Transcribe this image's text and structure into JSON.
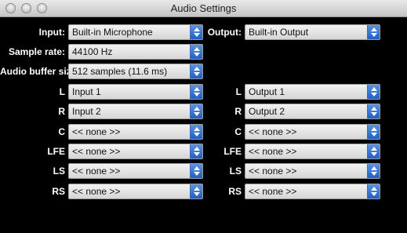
{
  "window": {
    "title": "Audio Settings"
  },
  "labels": {
    "input": "Input:",
    "output": "Output:",
    "sample_rate": "Sample rate:",
    "buffer_size": "Audio buffer size:"
  },
  "selects": {
    "input_device": "Built-in Microphone",
    "output_device": "Built-in Output",
    "sample_rate": "44100 Hz",
    "buffer_size": "512 samples (11.6 ms)"
  },
  "channels": [
    {
      "label": "L",
      "input": "Input 1",
      "output": "Output 1"
    },
    {
      "label": "R",
      "input": "Input 2",
      "output": "Output 2"
    },
    {
      "label": "C",
      "input": "<< none >>",
      "output": "<< none >>"
    },
    {
      "label": "LFE",
      "input": "<< none >>",
      "output": "<< none >>"
    },
    {
      "label": "LS",
      "input": "<< none >>",
      "output": "<< none >>"
    },
    {
      "label": "RS",
      "input": "<< none >>",
      "output": "<< none >>"
    }
  ],
  "colors": {
    "background": "#000000",
    "accent": "#2a6dd6",
    "label": "#ffffff"
  },
  "icons": {
    "stepper": "up-down-arrows-icon",
    "traffic_lights": "window-control-icon"
  }
}
